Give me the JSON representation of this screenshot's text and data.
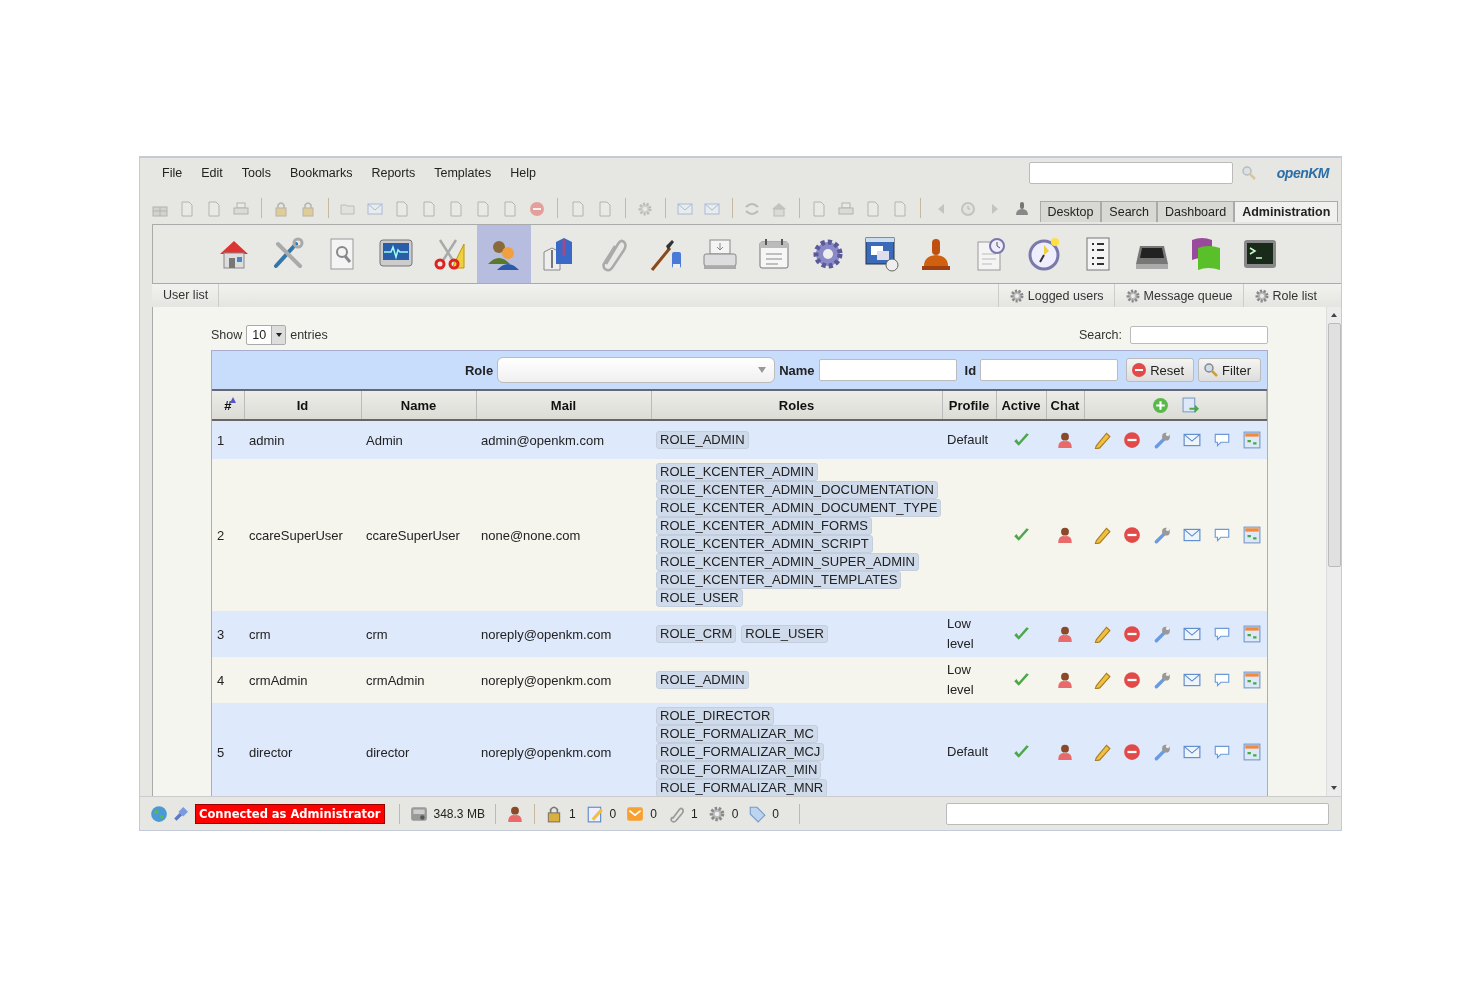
{
  "menu": [
    "File",
    "Edit",
    "Tools",
    "Bookmarks",
    "Reports",
    "Templates",
    "Help"
  ],
  "logo": "openKM",
  "toolbar": [
    [
      {
        "disabled": true
      },
      {
        "disabled": true
      },
      {
        "disabled": true
      },
      {
        "disabled": true
      }
    ],
    [
      {
        "disabled": true
      },
      {
        "disabled": true
      }
    ],
    [
      {
        "disabled": true
      },
      {
        "disabled": true
      },
      {
        "disabled": true
      },
      {
        "disabled": true
      },
      {
        "disabled": true
      },
      {
        "disabled": true
      },
      {
        "disabled": true
      },
      {
        "disabled": true
      }
    ],
    [
      {
        "disabled": true
      },
      {
        "disabled": true
      }
    ],
    [
      {
        "disabled": true
      }
    ],
    [
      {
        "disabled": true
      },
      {
        "disabled": true
      }
    ],
    [
      {
        "disabled": true
      },
      {
        "disabled": true
      }
    ],
    [
      {
        "disabled": true
      },
      {
        "disabled": true
      },
      {
        "disabled": true
      },
      {
        "disabled": true
      }
    ],
    [
      {
        "disabled": true
      },
      {
        "disabled": true
      },
      {
        "disabled": true
      },
      {
        "disabled": false
      }
    ]
  ],
  "tabs": [
    {
      "label": "Desktop",
      "selected": false
    },
    {
      "label": "Search",
      "selected": false
    },
    {
      "label": "Dashboard",
      "selected": false
    },
    {
      "label": "Administration",
      "selected": true
    }
  ],
  "admin_tools": [
    {
      "selected": false
    },
    {
      "selected": false
    },
    {
      "selected": false
    },
    {
      "selected": false
    },
    {
      "selected": false
    },
    {
      "selected": true
    },
    {
      "selected": false
    },
    {
      "selected": false
    },
    {
      "selected": false
    },
    {
      "selected": false
    },
    {
      "selected": false
    },
    {
      "selected": false
    },
    {
      "selected": false
    },
    {
      "selected": false
    },
    {
      "selected": false
    },
    {
      "selected": false
    },
    {
      "selected": false
    },
    {
      "selected": false
    },
    {
      "selected": false
    },
    {
      "selected": false
    }
  ],
  "breadcrumb": "User list",
  "admin_links": [
    "Logged users",
    "Message queue",
    "Role list"
  ],
  "length_menu": {
    "before": "Show",
    "value": "10",
    "after": "entries"
  },
  "search_label": "Search:",
  "filter": {
    "role_label": "Role",
    "name_label": "Name",
    "id_label": "Id",
    "buttons": [
      "Reset",
      "Filter"
    ]
  },
  "table": {
    "columns": [
      "#",
      "Id",
      "Name",
      "Mail",
      "Roles",
      "Profile",
      "Active",
      "Chat"
    ],
    "rows": [
      {
        "number": "1",
        "id": "admin",
        "name": "Admin",
        "mail": "admin@openkm.com",
        "roles": [
          "ROLE_ADMIN"
        ],
        "profile": "Default",
        "active": true
      },
      {
        "number": "2",
        "id": "ccareSuperUser",
        "name": "ccareSuperUser",
        "mail": "none@none.com",
        "roles": [
          "ROLE_KCENTER_ADMIN",
          "ROLE_KCENTER_ADMIN_DOCUMENTATION",
          "ROLE_KCENTER_ADMIN_DOCUMENT_TYPE",
          "ROLE_KCENTER_ADMIN_FORMS",
          "ROLE_KCENTER_ADMIN_SCRIPT",
          "ROLE_KCENTER_ADMIN_SUPER_ADMIN",
          "ROLE_KCENTER_ADMIN_TEMPLATES",
          "ROLE_USER"
        ],
        "active": true
      },
      {
        "number": "3",
        "id": "crm",
        "name": "crm",
        "mail": "noreply@openkm.com",
        "roles": [
          "ROLE_CRM",
          "ROLE_USER"
        ],
        "profile": "Low level",
        "active": true
      },
      {
        "number": "4",
        "id": "crmAdmin",
        "name": "crmAdmin",
        "mail": "noreply@openkm.com",
        "roles": [
          "ROLE_ADMIN"
        ],
        "profile": "Low level",
        "active": true
      },
      {
        "number": "5",
        "id": "director",
        "name": "director",
        "mail": "noreply@openkm.com",
        "roles": [
          "ROLE_DIRECTOR",
          "ROLE_FORMALIZAR_MC",
          "ROLE_FORMALIZAR_MCJ",
          "ROLE_FORMALIZAR_MIN",
          "ROLE_FORMALIZAR_MNR"
        ],
        "profile": "Default",
        "active": true
      }
    ]
  },
  "status_bar": {
    "connection": "Connected as Administrator",
    "repository_size": "348.3 MB",
    "counters": [
      "1",
      "0",
      "0",
      "1",
      "0",
      "0"
    ]
  }
}
